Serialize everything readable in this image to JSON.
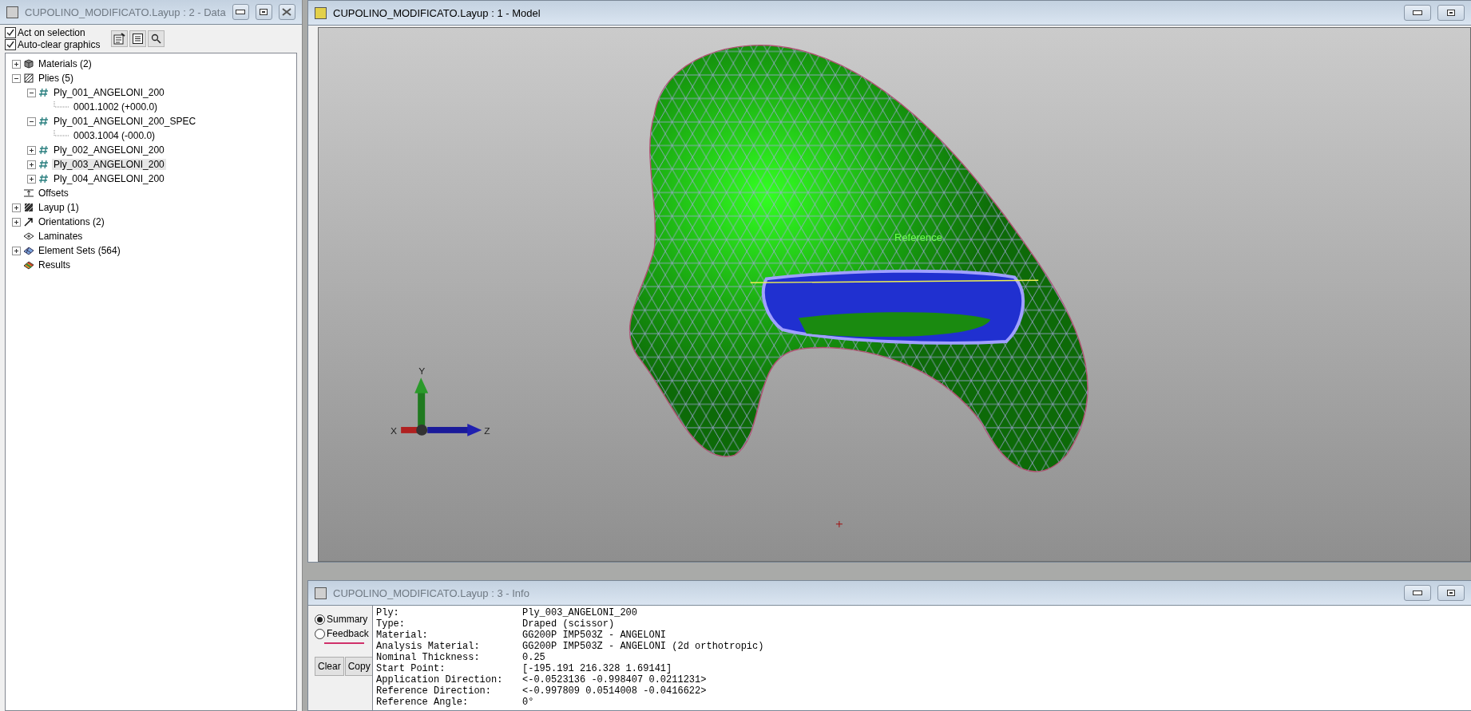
{
  "data_window": {
    "title": "CUPOLINO_MODIFICATO.Layup : 2 - Data",
    "active": false,
    "options": [
      {
        "label": "Act on selection",
        "checked": true
      },
      {
        "label": "Auto-clear graphics",
        "checked": true
      }
    ],
    "tree": [
      {
        "label": "Materials (2)",
        "kind": "material",
        "expanded": false,
        "selected": false
      },
      {
        "label": "Plies (5)",
        "kind": "plies",
        "expanded": true,
        "selected": false,
        "children": [
          {
            "label": "Ply_001_ANGELONI_200",
            "kind": "ply",
            "expanded": true,
            "selected": false,
            "children": [
              {
                "label": "0001.1002 (+000.0)",
                "kind": "leaf",
                "selected": false
              }
            ]
          },
          {
            "label": "Ply_001_ANGELONI_200_SPEC",
            "kind": "ply",
            "expanded": true,
            "selected": false,
            "children": [
              {
                "label": "0003.1004 (-000.0)",
                "kind": "leaf",
                "selected": false
              }
            ]
          },
          {
            "label": "Ply_002_ANGELONI_200",
            "kind": "ply",
            "expanded": false,
            "selected": false
          },
          {
            "label": "Ply_003_ANGELONI_200",
            "kind": "ply",
            "expanded": false,
            "selected": true
          },
          {
            "label": "Ply_004_ANGELONI_200",
            "kind": "ply",
            "expanded": false,
            "selected": false
          }
        ]
      },
      {
        "label": "Offsets",
        "kind": "offset",
        "selected": false
      },
      {
        "label": "Layup (1)",
        "kind": "layup",
        "expanded": false,
        "selected": false
      },
      {
        "label": "Orientations (2)",
        "kind": "orientation",
        "expanded": false,
        "selected": false
      },
      {
        "label": "Laminates",
        "kind": "laminate",
        "selected": false
      },
      {
        "label": "Element Sets (564)",
        "kind": "elementset",
        "expanded": false,
        "selected": false
      },
      {
        "label": "Results",
        "kind": "results",
        "selected": false
      }
    ]
  },
  "model_window": {
    "title": "CUPOLINO_MODIFICATO.Layup : 1 - Model",
    "active": true,
    "annotation": "Reference",
    "axes": {
      "x": "X",
      "y": "Y",
      "z": "Z"
    }
  },
  "info_window": {
    "title": "CUPOLINO_MODIFICATO.Layup : 3 - Info",
    "active": false,
    "modes": [
      {
        "label": "Summary",
        "selected": true
      },
      {
        "label": "Feedback",
        "selected": false
      }
    ],
    "buttons": [
      "Clear",
      "Copy"
    ],
    "rows": [
      {
        "label": "Ply:",
        "value": "Ply_003_ANGELONI_200"
      },
      {
        "label": "Type:",
        "value": "Draped (scissor)"
      },
      {
        "label": "Material:",
        "value": "GG200P IMP503Z - ANGELONI"
      },
      {
        "label": "Analysis Material:",
        "value": "GG200P IMP503Z - ANGELONI (2d orthotropic)"
      },
      {
        "label": "Nominal Thickness:",
        "value": "0.25"
      },
      {
        "label": "Start Point:",
        "value": "[-195.191 216.328 1.69141]"
      },
      {
        "label": "Application Direction:",
        "value": "<-0.0523136 -0.998407 0.0211231>"
      },
      {
        "label": "Reference Direction:",
        "value": "<-0.997809 0.0514008 -0.0416622>"
      },
      {
        "label": "Reference Angle:",
        "value": "0°"
      }
    ]
  }
}
